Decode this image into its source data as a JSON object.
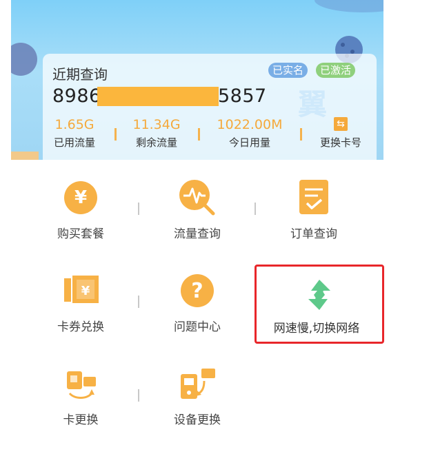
{
  "header": {
    "card_title": "近期查询",
    "badges": [
      "已实名",
      "已激活"
    ],
    "number_prefix": "8986",
    "number_suffix": "5857",
    "watermark": "翼",
    "stats": [
      {
        "value": "1.65G",
        "label": "已用流量"
      },
      {
        "value": "11.34G",
        "label": "剩余流量"
      },
      {
        "value": "1022.00M",
        "label": "今日用量"
      }
    ],
    "swap_label": "更换卡号",
    "swap_glyph": "⇆"
  },
  "grid": {
    "items": [
      {
        "label": "购买套餐",
        "icon": "yen-coin-icon",
        "glyph": "¥"
      },
      {
        "label": "流量查询",
        "icon": "traffic-search-icon"
      },
      {
        "label": "订单查询",
        "icon": "order-check-icon"
      },
      {
        "label": "卡券兑换",
        "icon": "coupon-ticket-icon",
        "glyph": "¥"
      },
      {
        "label": "问题中心",
        "icon": "question-icon",
        "glyph": "?"
      },
      {
        "label": "网速慢,切换网络",
        "icon": "network-switch-icon"
      },
      {
        "label": "卡更换",
        "icon": "sim-swap-icon"
      },
      {
        "label": "设备更换",
        "icon": "device-swap-icon"
      }
    ]
  },
  "colors": {
    "accent": "#f7b145",
    "highlight_border": "#e8262a",
    "switch_green": "#5ec98a"
  }
}
